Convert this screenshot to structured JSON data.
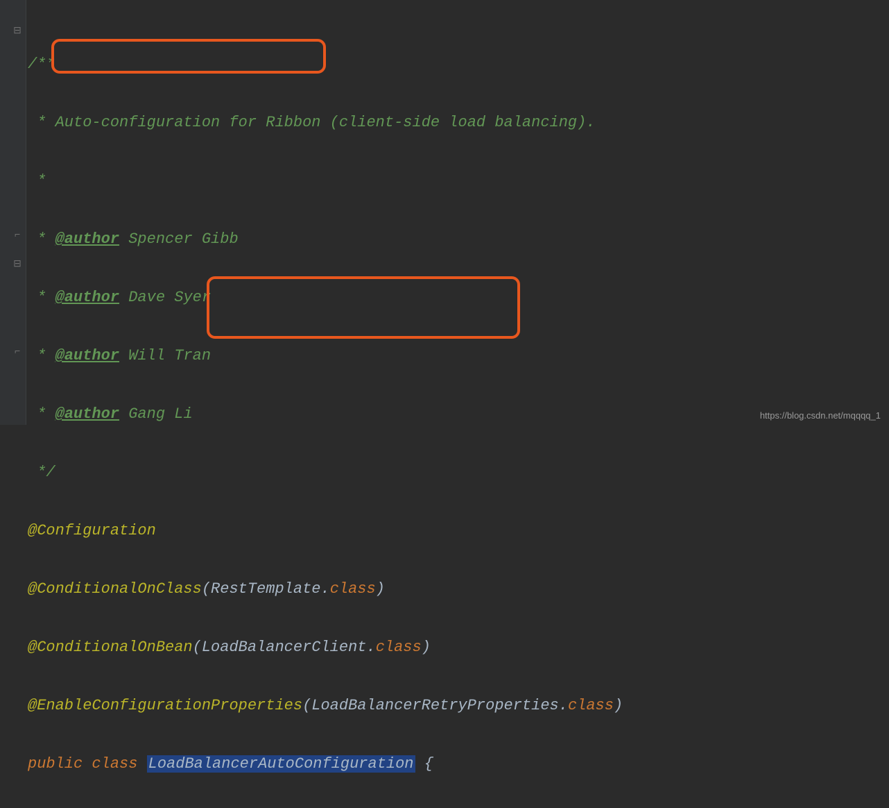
{
  "code": {
    "l1": "/**",
    "l2_prefix": " * ",
    "l2_text": "Auto-configuration for Ribbon (client-side load balancing).",
    "l3": " *",
    "l4_prefix": " * ",
    "l4_tag": "@author",
    "l4_name": " Spencer Gibb",
    "l5_prefix": " * ",
    "l5_tag": "@author",
    "l5_name": " Dave Syer",
    "l6_prefix": " * ",
    "l6_tag": "@author",
    "l6_name": " Will Tran",
    "l7_prefix": " * ",
    "l7_tag": "@author",
    "l7_name": " Gang Li",
    "l8": " */",
    "l9": "@Configuration",
    "l10_anno": "@ConditionalOnClass",
    "l10_paren_open": "(",
    "l10_arg": "RestTemplate.",
    "l10_class": "class",
    "l10_paren_close": ")",
    "l11_anno": "@ConditionalOnBean",
    "l11_paren_open": "(",
    "l11_arg": "LoadBalancerClient.",
    "l11_class": "class",
    "l11_paren_close": ")",
    "l12_anno": "@EnableConfigurationProperties",
    "l12_paren_open": "(",
    "l12_arg": "LoadBalancerRetryProperties.",
    "l12_class": "class",
    "l12_paren_close": ")",
    "l13_public": "public ",
    "l13_class": "class ",
    "l13_name": "LoadBalancerAutoConfiguration",
    "l13_brace": " {"
  },
  "watermark": "https://blog.csdn.net/mqqqq_1"
}
